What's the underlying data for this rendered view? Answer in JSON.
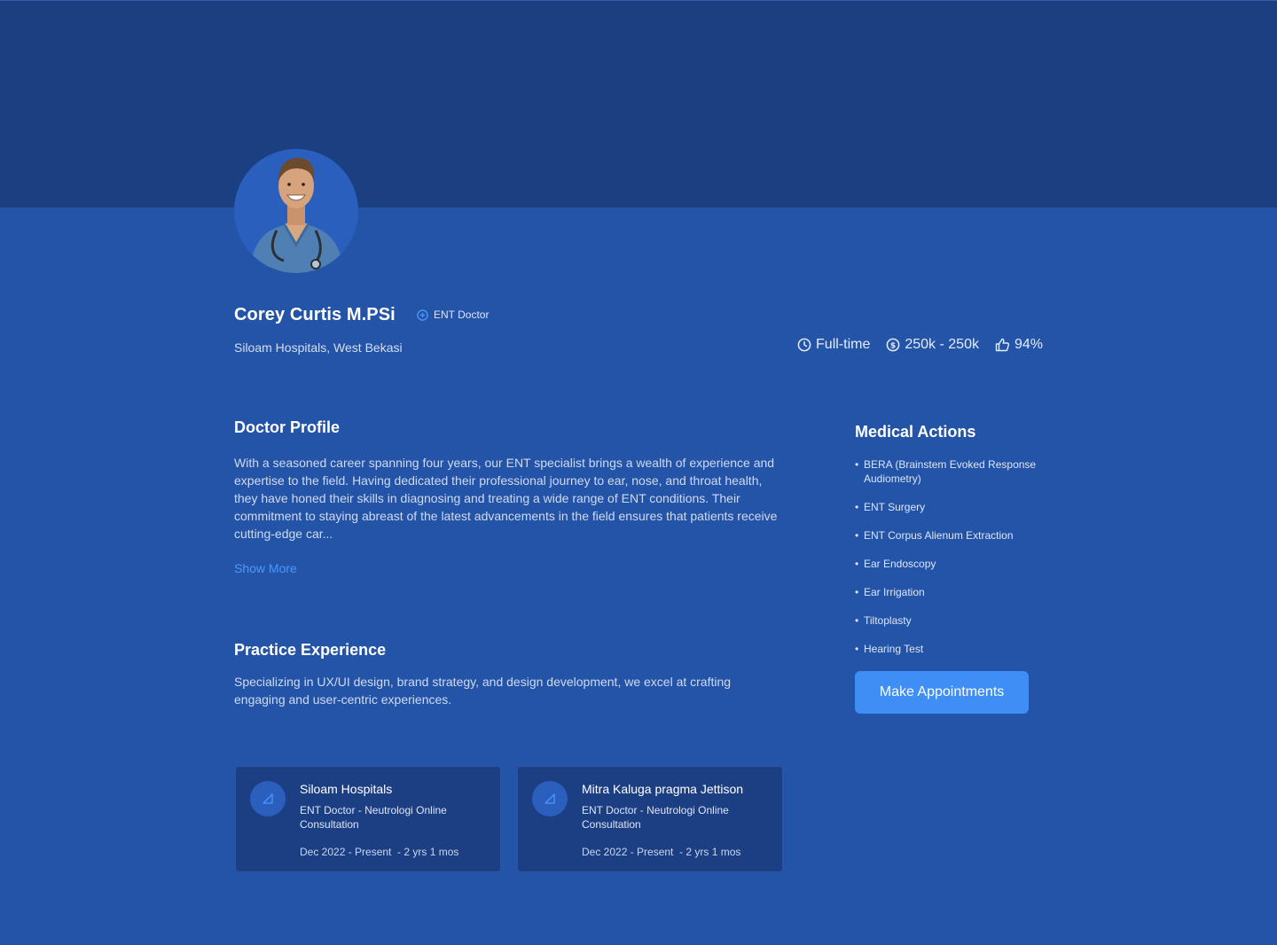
{
  "doctor": {
    "name": "Corey Curtis M.PSi",
    "role": "ENT Doctor",
    "hospital": "Siloam Hospitals, West Bekasi"
  },
  "stats": {
    "employment": "Full-time",
    "fee": "250k - 250k",
    "rating": "94%"
  },
  "profile": {
    "title": "Doctor Profile",
    "text": "With a seasoned career spanning four years, our ENT specialist brings a wealth of experience and expertise to the field. Having dedicated their professional journey to ear, nose, and throat health, they have honed their skills in diagnosing and treating a wide range of ENT conditions. Their commitment to staying abreast of the latest advancements in the field ensures that patients receive cutting-edge car...",
    "show_more": "Show More"
  },
  "experience": {
    "title": "Practice Experience",
    "text": "Specializing in UX/UI design, brand strategy, and design development, we excel at crafting engaging and user-centric experiences.",
    "cards": [
      {
        "title": "Siloam Hospitals",
        "subtitle": "ENT Doctor - Neutrologi Online Consultation",
        "period": "Dec 2022 - Present  - 2 yrs 1 mos"
      },
      {
        "title": "Mitra Kaluga pragma Jettison",
        "subtitle": "ENT Doctor - Neutrologi Online Consultation",
        "period": "Dec 2022 - Present  - 2 yrs 1 mos"
      }
    ]
  },
  "medical_actions": {
    "title": "Medical Actions",
    "items": [
      "BERA (Brainstem Evoked Response Audiometry)",
      "ENT Surgery",
      "ENT Corpus Alienum Extraction",
      "Ear Endoscopy",
      "Ear Irrigation",
      "Tiltoplasty",
      "Hearing Test"
    ],
    "cta": "Make Appointments"
  },
  "icons": {
    "role": "plus-circle-icon",
    "employment": "clock-icon",
    "fee": "dollar-circle-icon",
    "rating": "thumbs-up-icon",
    "card": "edit-triangle-icon"
  },
  "colors": {
    "cover": "#1b3f80",
    "background": "#2454a7",
    "accent": "#3f8ef6",
    "link": "#4a98ff",
    "card": "#1c3f84"
  }
}
